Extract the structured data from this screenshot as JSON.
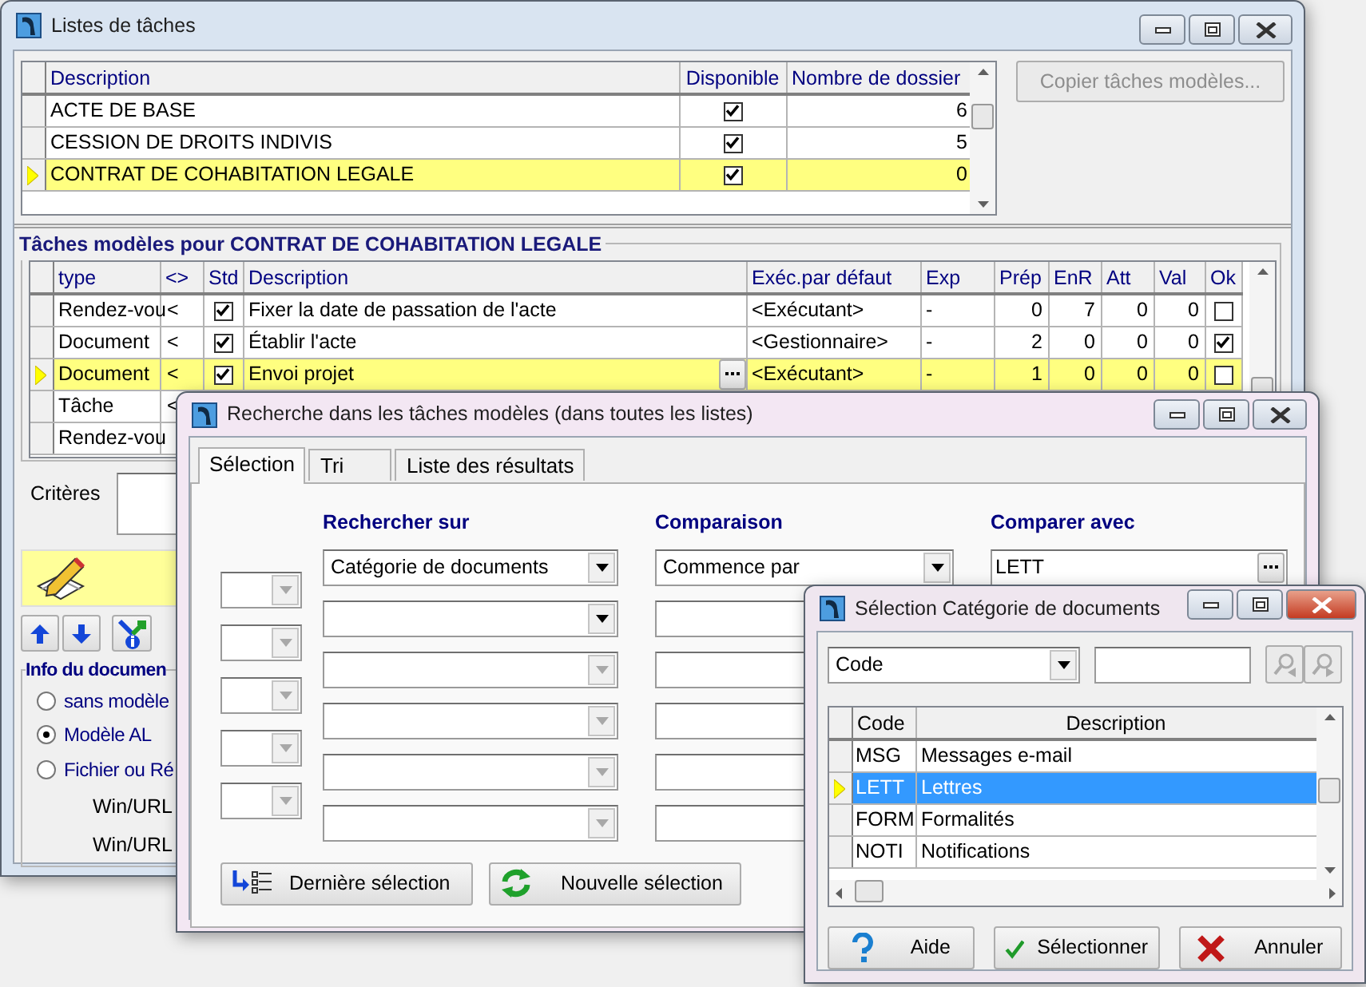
{
  "main_window": {
    "title": "Listes de tâches",
    "task_lists": {
      "columns": [
        "Description",
        "Disponible",
        "Nombre de dossier"
      ],
      "rows": [
        {
          "description": "ACTE DE BASE",
          "available": true,
          "count": "6",
          "selected": false
        },
        {
          "description": "CESSION DE DROITS INDIVIS",
          "available": true,
          "count": "5",
          "selected": false
        },
        {
          "description": "CONTRAT DE COHABITATION LEGALE",
          "available": true,
          "count": "0",
          "selected": true
        }
      ]
    },
    "copy_button": {
      "label": "Copier tâches modèles...",
      "disabled": true
    },
    "template_tasks": {
      "title": "Tâches modèles pour CONTRAT DE COHABITATION LEGALE",
      "columns": [
        "type",
        "<>",
        "Std",
        "Description",
        "Exéc.par défaut",
        "Exp",
        "Prép",
        "EnR",
        "Att",
        "Val",
        "Ok"
      ],
      "rows": [
        {
          "type": "Rendez-vou",
          "direction": "<",
          "standard": true,
          "description": "Fixer la date de passation de l'acte",
          "executor": "<Exécutant>",
          "exp": "-",
          "prep": "0",
          "enr": "7",
          "att": "0",
          "val": "0",
          "ok": false,
          "selected": false
        },
        {
          "type": "Document",
          "direction": "<",
          "standard": true,
          "description": "Établir l'acte",
          "executor": "<Gestionnaire>",
          "exp": "-",
          "prep": "2",
          "enr": "0",
          "att": "0",
          "val": "0",
          "ok": true,
          "selected": false
        },
        {
          "type": "Document",
          "direction": "<",
          "standard": true,
          "description": "Envoi projet",
          "executor": "<Exécutant>",
          "exp": "-",
          "prep": "1",
          "enr": "0",
          "att": "0",
          "val": "0",
          "ok": false,
          "selected": true
        },
        {
          "type": "Tâche",
          "direction": "<",
          "selected": false
        },
        {
          "type": "Rendez-vou",
          "selected": false
        }
      ]
    },
    "criteria_label": "Critères",
    "document_info": {
      "title": "Info du documen",
      "options": [
        {
          "label": "sans modèle",
          "selected": false
        },
        {
          "label": "Modèle AL",
          "selected": true
        },
        {
          "label": "Fichier ou Ré",
          "selected": false
        }
      ],
      "field_labels": [
        "Win/URL",
        "Win/URL"
      ]
    }
  },
  "search_dialog": {
    "title": "Recherche dans les tâches modèles (dans toutes les listes)",
    "tabs": [
      {
        "label": "Sélection",
        "selected": true
      },
      {
        "label": "Tri",
        "selected": false
      },
      {
        "label": "Liste des résultats",
        "selected": false
      }
    ],
    "column_headers": [
      "Rechercher sur",
      "Comparaison",
      "Comparer avec"
    ],
    "criteria": [
      {
        "field": "Catégorie de documents",
        "comparison": "Commence par",
        "value": "LETT",
        "disabled": false
      },
      {
        "disabled": false
      },
      {
        "disabled": true
      },
      {
        "disabled": true
      },
      {
        "disabled": true
      },
      {
        "disabled": true
      }
    ],
    "buttons": [
      {
        "label": "Dernière sélection",
        "kind": "last"
      },
      {
        "label": "Nouvelle sélection",
        "kind": "new"
      }
    ]
  },
  "category_dialog": {
    "title": "Sélection Catégorie de documents",
    "search_by": "Code",
    "columns": [
      "Code",
      "Description"
    ],
    "rows": [
      {
        "code": "MSG",
        "description": "Messages e-mail",
        "selected": false
      },
      {
        "code": "LETT",
        "description": "Lettres",
        "selected": true
      },
      {
        "code": "FORM",
        "description": "Formalités",
        "selected": false
      },
      {
        "code": "NOTI",
        "description": "Notifications",
        "selected": false
      }
    ],
    "buttons": [
      {
        "label": "Aide",
        "kind": "help"
      },
      {
        "label": "Sélectionner",
        "kind": "select"
      },
      {
        "label": "Annuler",
        "kind": "cancel"
      }
    ]
  }
}
